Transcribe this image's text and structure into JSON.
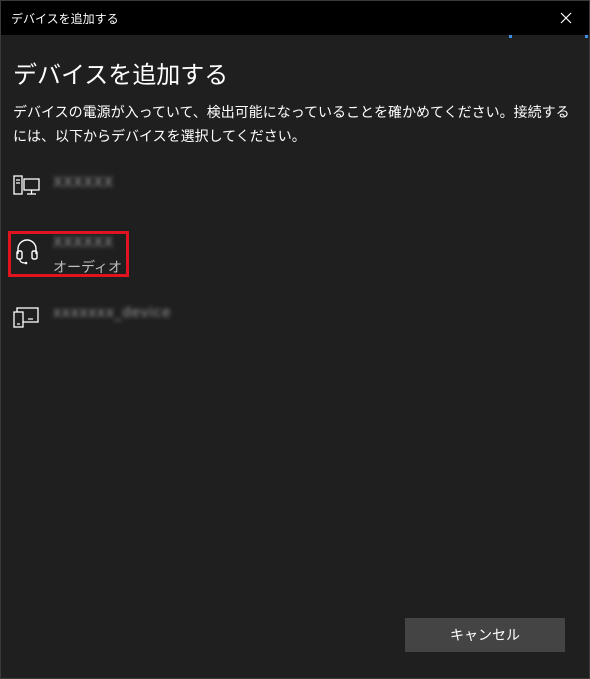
{
  "window": {
    "title": "デバイスを追加する"
  },
  "heading": "デバイスを追加する",
  "instructions": "デバイスの電源が入っていて、検出可能になっていることを確かめてください。接続するには、以下からデバイスを選択してください。",
  "devices": [
    {
      "name": "XXXXXX",
      "type": "",
      "icon": "desktop-computer-icon"
    },
    {
      "name": "XXXXXX",
      "type": "オーディオ",
      "icon": "headset-icon"
    },
    {
      "name": "xxxxxxx_device",
      "type": "",
      "icon": "display-device-icon"
    }
  ],
  "buttons": {
    "cancel": "キャンセル"
  },
  "colors": {
    "accent": "#3a8ee6",
    "highlight": "#e0141e",
    "background": "#1f1f1f",
    "button": "#444444"
  }
}
